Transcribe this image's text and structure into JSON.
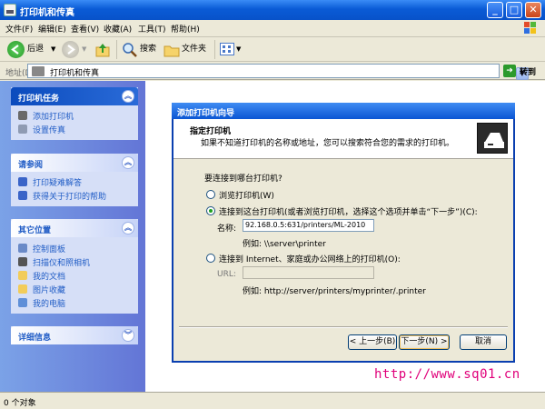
{
  "window": {
    "title": "打印机和传真",
    "min": "_",
    "max": "□",
    "close": "✕"
  },
  "menu": [
    "文件(F)",
    "编辑(E)",
    "查看(V)",
    "收藏(A)",
    "工具(T)",
    "帮助(H)"
  ],
  "toolbar": {
    "back": "后退",
    "search": "搜索",
    "folders": "文件夹"
  },
  "address": {
    "label": "地址(D)",
    "value": "打印机和传真",
    "go": "转到"
  },
  "left_panels": [
    {
      "title": "打印机任务",
      "items": [
        "添加打印机",
        "设置传真"
      ]
    },
    {
      "title": "请参阅",
      "items": [
        "打印疑难解答",
        "获得关于打印的帮助"
      ]
    },
    {
      "title": "其它位置",
      "items": [
        "控制面板",
        "扫描仪和照相机",
        "我的文档",
        "图片收藏",
        "我的电脑"
      ]
    },
    {
      "title": "详细信息",
      "items": []
    }
  ],
  "status": {
    "text": "0 个对象"
  },
  "dialog": {
    "title": "添加打印机向导",
    "header_title": "指定打印机",
    "header_desc": "如果不知道打印机的名称或地址，您可以搜索符合您的需求的打印机。",
    "question": "要连接到哪台打印机?",
    "option_browse": "浏览打印机(W)",
    "option_connect": "连接到这台打印机(或者浏览打印机，选择这个选项并单击“下一步”)(C):",
    "name_label": "名称:",
    "name_value": "92.168.0.5:631/printers/ML-2010",
    "name_example": "例如: \\\\server\\printer",
    "option_internet": "连接到 Internet、家庭或办公网络上的打印机(O):",
    "url_label": "URL:",
    "url_value": "",
    "url_example": "例如: http://server/printers/myprinter/.printer",
    "btn_back": "< 上一步(B)",
    "btn_next": "下一步(N) >",
    "btn_cancel": "取消"
  },
  "watermark": "http://www.sq01.cn"
}
